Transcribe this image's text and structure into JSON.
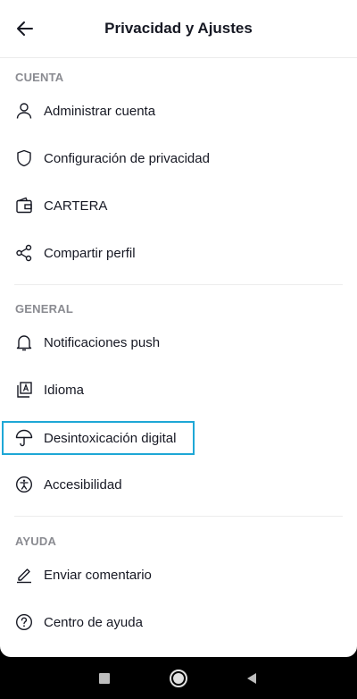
{
  "header": {
    "title": "Privacidad y Ajustes"
  },
  "sections": {
    "cuenta": {
      "label": "CUENTA",
      "items": [
        {
          "label": "Administrar cuenta",
          "icon": "person-icon"
        },
        {
          "label": "Configuración de privacidad",
          "icon": "shield-icon"
        },
        {
          "label": "CARTERA",
          "icon": "wallet-icon"
        },
        {
          "label": "Compartir perfil",
          "icon": "share-icon"
        }
      ]
    },
    "general": {
      "label": "GENERAL",
      "items": [
        {
          "label": "Notificaciones push",
          "icon": "bell-icon"
        },
        {
          "label": "Idioma",
          "icon": "language-icon"
        },
        {
          "label": "Desintoxicación digital",
          "icon": "umbrella-icon"
        },
        {
          "label": "Accesibilidad",
          "icon": "accessibility-icon"
        }
      ]
    },
    "ayuda": {
      "label": "AYUDA",
      "items": [
        {
          "label": "Enviar comentario",
          "icon": "pencil-icon"
        },
        {
          "label": "Centro de ayuda",
          "icon": "help-icon"
        }
      ]
    }
  },
  "colors": {
    "highlight": "#1ea7d6",
    "text": "#161823",
    "section": "#8a8b91"
  }
}
